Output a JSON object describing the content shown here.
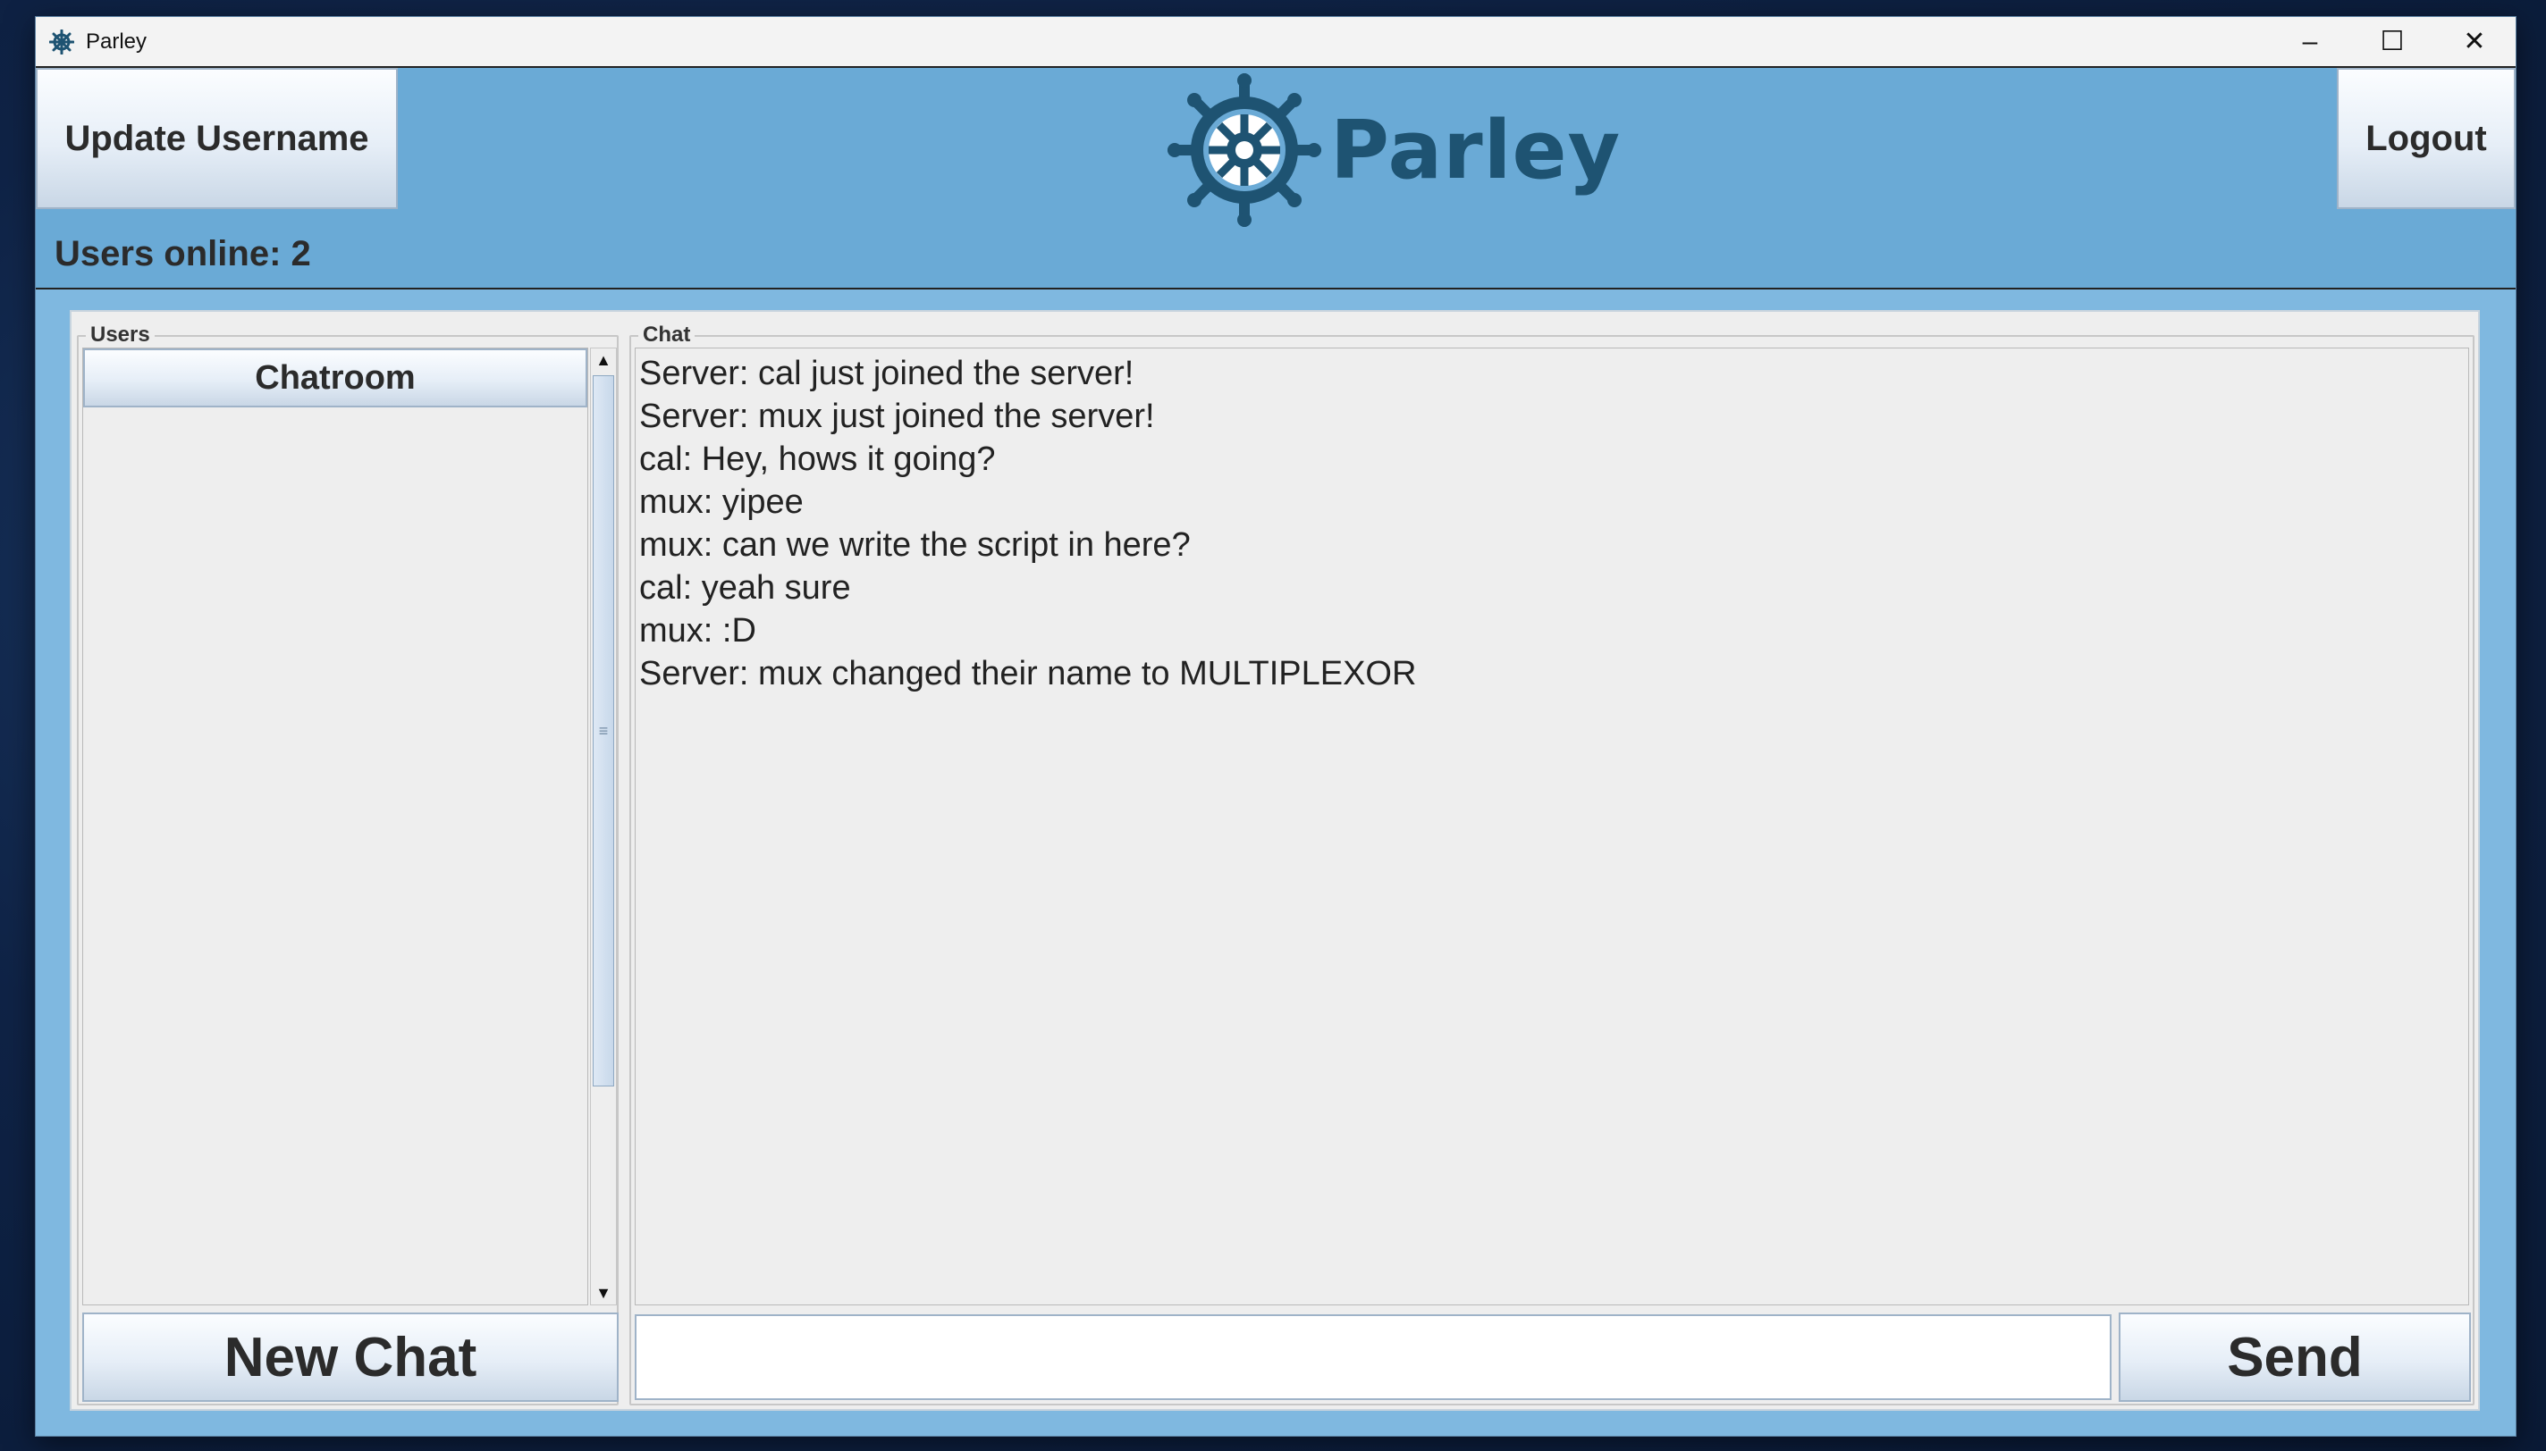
{
  "window": {
    "title": "Parley",
    "controls": {
      "minimize": "–",
      "maximize": "☐",
      "close": "✕"
    }
  },
  "header": {
    "update_button": "Update Username",
    "logout_button": "Logout",
    "logo_text": "Parley",
    "users_online": "Users online: 2"
  },
  "users_panel": {
    "legend": "Users",
    "items": [
      {
        "label": "Chatroom"
      }
    ],
    "new_chat_button": "New Chat"
  },
  "chat_panel": {
    "legend": "Chat",
    "messages": [
      "Server: cal just joined the server!",
      "Server: mux just joined the server!",
      "cal: Hey, hows it going?",
      "mux: yipee",
      "mux: can we write the script in here?",
      "cal: yeah sure",
      "mux: :D",
      "Server: mux changed their name to MULTIPLEXOR"
    ],
    "input_value": "",
    "send_button": "Send"
  },
  "colors": {
    "header_bg": "#6aaad6",
    "window_bg": "#7fb8e0",
    "logo_color": "#1e5372"
  },
  "icons": [
    "ship-wheel-icon",
    "minimize-icon",
    "maximize-icon",
    "close-icon",
    "scroll-up-icon",
    "scroll-down-icon"
  ]
}
